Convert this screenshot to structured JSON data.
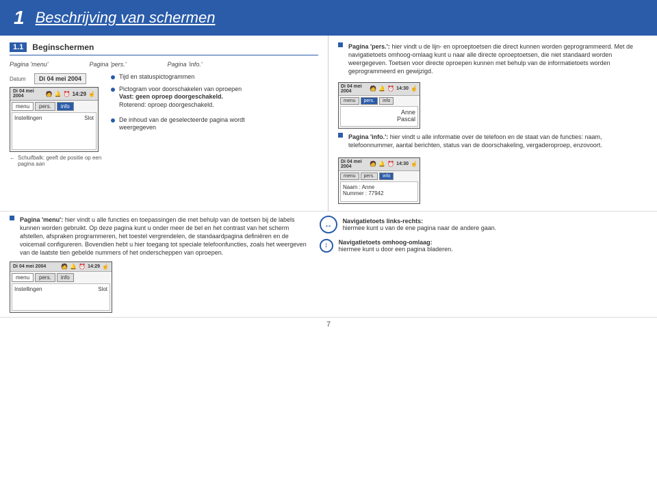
{
  "header": {
    "chapter_num": "1",
    "chapter_title": "Beschrijving van schermen"
  },
  "section": {
    "num": "1.1",
    "title": "Beginschermen"
  },
  "labels": {
    "pagina_menu": "Pagina 'menu'",
    "pagina_pers": "Pagina 'pers.'",
    "pagina_info": "Pagina 'info.'"
  },
  "datum": {
    "label": "Datum",
    "value": "Di 04 mei 2004"
  },
  "tabs": {
    "menu": "menu",
    "pers": "pers.",
    "info": "info"
  },
  "phone_body": {
    "left_label": "Instellingen",
    "right_label": "Slot"
  },
  "schuifbalk": {
    "label": "Schuifbalk: geeft de positie op een pagina aan"
  },
  "tijd_label": "Tijd en statuspictogrammen",
  "pictogram_label": "Pictogram voor doorschakelen van oproepen",
  "pictogram_vast": "Vast: geen oproep doorgeschakeld.",
  "pictogram_roterend": "Roterend: oproep doorgeschakeld.",
  "inhoud_label": "De inhoud van de geselecteerde pagina wordt weergegeven",
  "status_icons": "🧑 🔔 ⏰",
  "time_value": "14:29",
  "time_value2": "14:30",
  "names": {
    "anne": "Anne",
    "pascal": "Pascal"
  },
  "naam_nummer": {
    "naam": "Naam : Anne",
    "nummer": "Nummer : 77942"
  },
  "right_col": {
    "pagina_pers_label": "Pagina 'pers.':",
    "pagina_pers_text": "hier vindt u de lijn- en oproeptoetsen die direct kunnen worden geprogrammeerd. Met de navigatietoets omhoog-omlaag kunt u naar alle directe oproeptoetsen, die niet standaard worden weergegeven. Toetsen voor directe oproepen kunnen met behulp van de informatietoets worden geprogrammeerd en gewijzigd.",
    "pagina_info_label": "Pagina 'info.':",
    "pagina_info_text": "hier vindt u alle informatie over de telefoon en de staat van de functies: naam, telefoonnummer, aantal berichten, status van de doorschakeling, vergaderoproep, enzovoort."
  },
  "bottom": {
    "pagina_menu_label": "Pagina 'menu':",
    "pagina_menu_text": "hier vindt u alle functies en toepassingen die met behulp van de toetsen bij de labels kunnen worden gebruikt. Op deze pagina kunt u onder meer de bel en het contrast van het scherm afstellen, afspraken programmeren, het toestel vergrendelen, de standaardpagina definiëren en de voicemail configureren. Bovendien hebt u hier toegang tot speciale telefoonfuncties, zoals het weergeven van de laatste tien gebelde nummers of het onderscheppen van oproepen.",
    "nav_lr_label": "Navigatietoets links-rechts:",
    "nav_lr_text": "hiermee kunt u van de ene pagina naar de andere gaan.",
    "nav_ud_label": "Navigatietoets omhoog-omlaag:",
    "nav_ud_text": "hiermee kunt u door een pagina bladeren."
  },
  "page_number": "7"
}
